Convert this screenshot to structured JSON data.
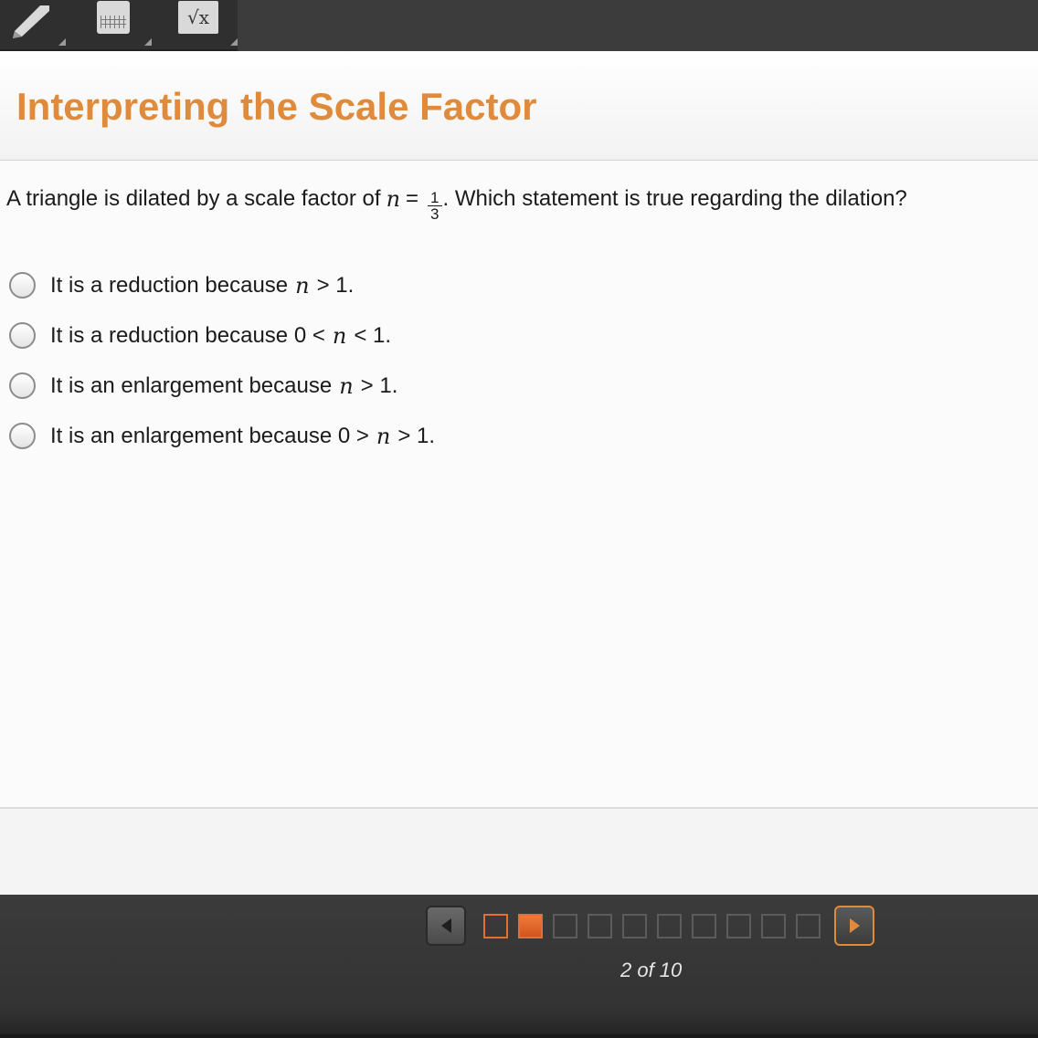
{
  "toolbar": {
    "tools": [
      {
        "name": "pencil",
        "icon": "pencil-icon"
      },
      {
        "name": "calculator",
        "icon": "calculator-icon"
      },
      {
        "name": "formula",
        "icon": "square-root-icon",
        "glyph": "√x"
      }
    ]
  },
  "header": {
    "title": "Interpreting the Scale Factor"
  },
  "question": {
    "prefix": "A triangle is dilated by a scale factor of",
    "variable": "n",
    "equals": "=",
    "fraction_numerator": "1",
    "fraction_denominator": "3",
    "suffix": ". Which statement is true regarding the dilation?"
  },
  "choices": [
    {
      "before": "It is a reduction because",
      "variable": "n",
      "after": "> 1."
    },
    {
      "before": "It is a reduction because 0 <",
      "variable": "n",
      "after": "< 1."
    },
    {
      "before": "It is an enlargement because",
      "variable": "n",
      "after": "> 1."
    },
    {
      "before": "It is an enlargement because 0 >",
      "variable": "n",
      "after": "> 1."
    }
  ],
  "navigation": {
    "current_page": 2,
    "total_pages": 10,
    "indicator": "2 of 10"
  },
  "colors": {
    "accent": "#e08a3c",
    "current_page": "#e07035",
    "toolbar_bg": "#3c3c3c",
    "navbar_bg": "#333333"
  }
}
